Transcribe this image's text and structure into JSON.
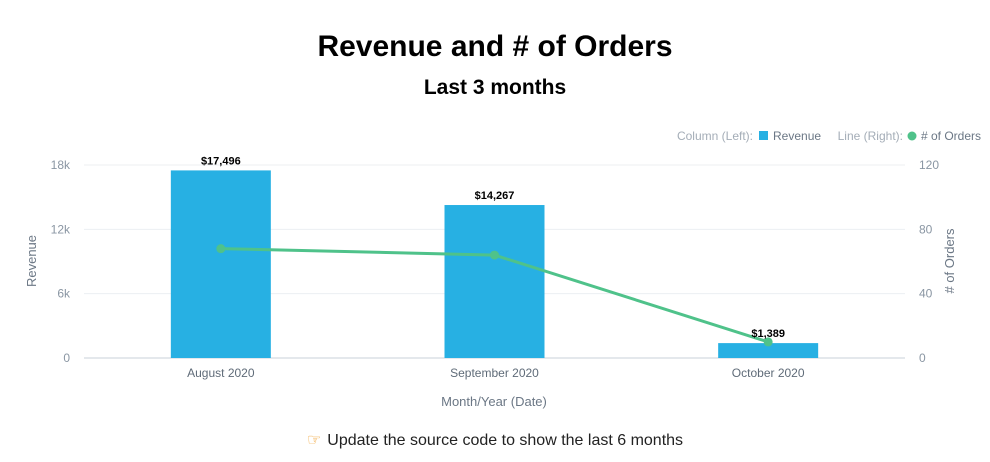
{
  "chart_data": {
    "type": "bar",
    "title": "Revenue and # of Orders",
    "subtitle": "Last 3 months",
    "categories": [
      "August 2020",
      "September 2020",
      "October 2020"
    ],
    "series": [
      {
        "name": "Revenue",
        "type": "bar",
        "axis": "left",
        "color": "#27b0e3",
        "values": [
          17496,
          14267,
          1389
        ],
        "labels": [
          "$17,496",
          "$14,267",
          "$1,389"
        ]
      },
      {
        "name": "# of Orders",
        "type": "line",
        "axis": "right",
        "color": "#4fc28a",
        "values": [
          68,
          64,
          10
        ]
      }
    ],
    "xlabel": "Month/Year (Date)",
    "ylabel": "Revenue",
    "ylabel_right": "# of Orders",
    "ylim": [
      0,
      18000
    ],
    "ylim_right": [
      0,
      120
    ],
    "yticks": [
      0,
      6000,
      12000,
      18000
    ],
    "ytick_labels": [
      "0",
      "6k",
      "12k",
      "18k"
    ],
    "yticks_right": [
      0,
      40,
      80,
      120
    ],
    "ytick_labels_right": [
      "0",
      "40",
      "80",
      "120"
    ],
    "legend": {
      "placement": "top-right",
      "bar_heading": "Column (Left):",
      "line_heading": "Line (Right):"
    },
    "grid": true
  },
  "footer": {
    "icon": "pointing-hand-icon",
    "text": "Update the source code to show the last 6 months"
  }
}
